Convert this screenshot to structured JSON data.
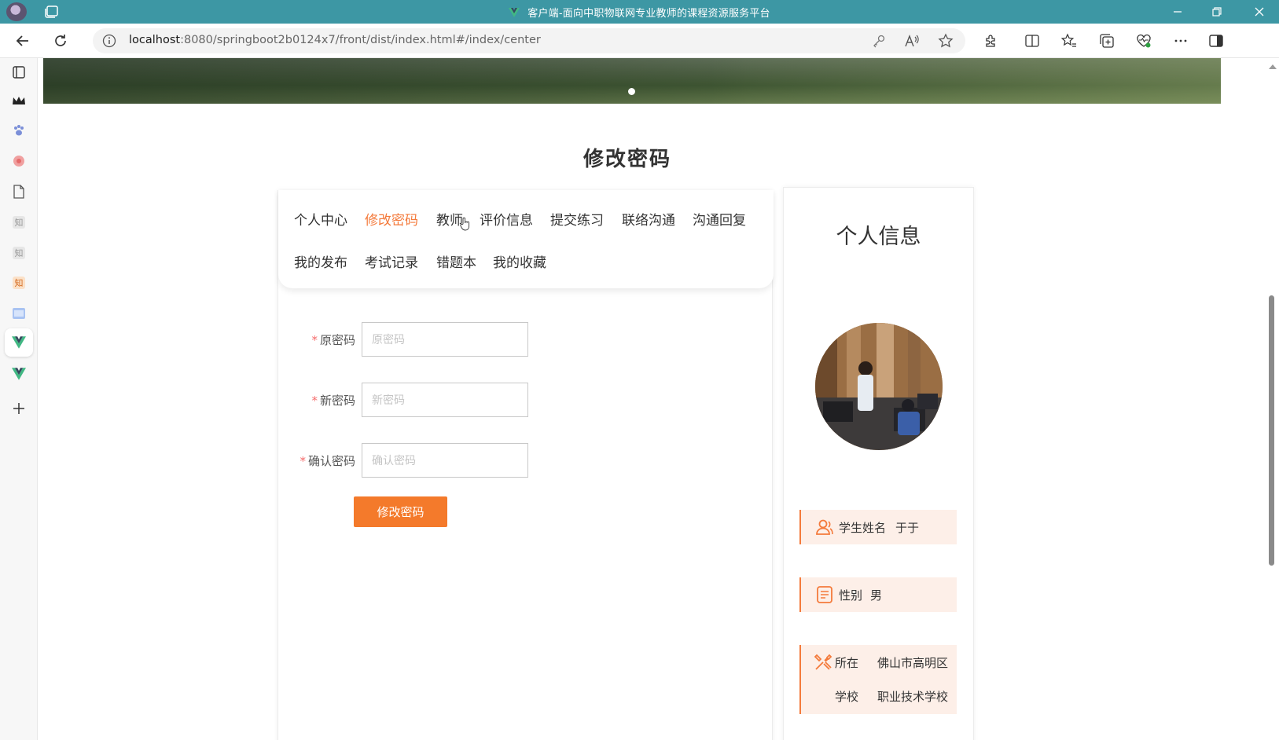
{
  "browser": {
    "window_title": "客户端-面向中职物联网专业教师的课程资源服务平台",
    "url_host": "localhost",
    "url_path": ":8080/springboot2b0124x7/front/dist/index.html#/index/center"
  },
  "page": {
    "section_title": "修改密码"
  },
  "menu": {
    "items": [
      {
        "label": "个人中心",
        "active": false
      },
      {
        "label": "修改密码",
        "active": true
      },
      {
        "label": "教师",
        "active": false
      },
      {
        "label": "评价信息",
        "active": false
      },
      {
        "label": "提交练习",
        "active": false
      },
      {
        "label": "联络沟通",
        "active": false
      },
      {
        "label": "沟通回复",
        "active": false
      },
      {
        "label": "我的发布",
        "active": false
      },
      {
        "label": "考试记录",
        "active": false
      },
      {
        "label": "错题本",
        "active": false
      },
      {
        "label": "我的收藏",
        "active": false
      }
    ]
  },
  "form": {
    "old_password": {
      "label": "原密码",
      "placeholder": "原密码",
      "value": ""
    },
    "new_password": {
      "label": "新密码",
      "placeholder": "新密码",
      "value": ""
    },
    "confirm_password": {
      "label": "确认密码",
      "placeholder": "确认密码",
      "value": ""
    },
    "required_mark": "*",
    "submit_label": "修改密码"
  },
  "profile": {
    "title": "个人信息",
    "name_label": "学生姓名",
    "name_value": "于于",
    "gender_label": "性别",
    "gender_value": "男",
    "location_label": "所在",
    "location_value": "佛山市高明区",
    "school_label": "学校",
    "school_value": "职业技术学校"
  },
  "colors": {
    "accent": "#f47a3b",
    "titlebar": "#3d97a4",
    "info_bg": "#fdefe8"
  },
  "icons": {
    "name": "user-icon",
    "gender": "document-icon",
    "location": "tools-icon"
  }
}
